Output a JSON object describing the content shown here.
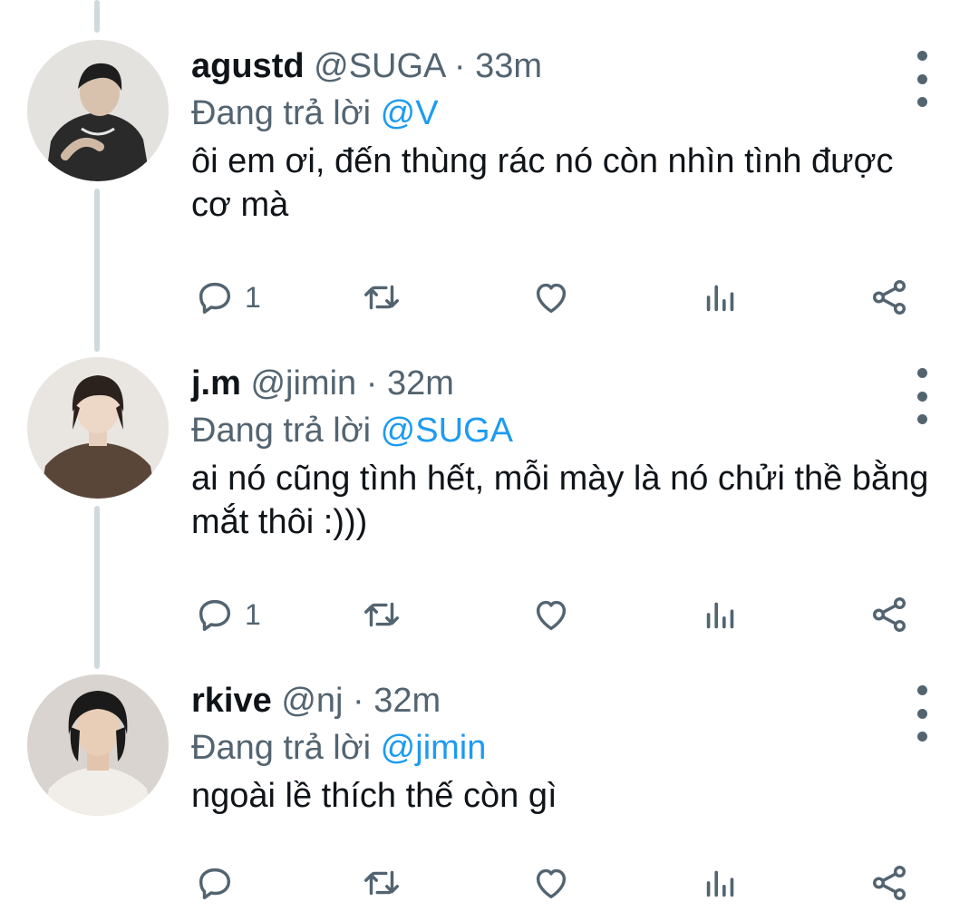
{
  "tweets": [
    {
      "name": "agustd",
      "handle": "@SUGA",
      "separator": "·",
      "time": "33m",
      "reply_prefix": "Đang trả lời",
      "reply_to": "@V",
      "text": "ôi em ơi, đến thùng rác nó còn nhìn tình được cơ mà",
      "reply_count": "1"
    },
    {
      "name": "j.m",
      "handle": "@jimin",
      "separator": "·",
      "time": "32m",
      "reply_prefix": "Đang trả lời",
      "reply_to": "@SUGA",
      "text": "ai nó cũng tình hết, mỗi mày là nó chửi thề bằng mắt thôi :)))",
      "reply_count": "1"
    },
    {
      "name": "rkive",
      "handle": "@nj",
      "separator": "·",
      "time": "32m",
      "reply_prefix": "Đang trả lời",
      "reply_to": "@jimin",
      "text": "ngoài lề thích thế còn gì",
      "reply_count": ""
    }
  ],
  "icons": {
    "reply": "reply-icon",
    "retweet": "retweet-icon",
    "like": "heart-icon",
    "views": "analytics-icon",
    "share": "share-icon",
    "more": "more-vertical-icon"
  },
  "colors": {
    "text": "#0f1419",
    "secondary": "#536471",
    "link": "#1d9bf0",
    "thread_line": "#cfd9de"
  }
}
